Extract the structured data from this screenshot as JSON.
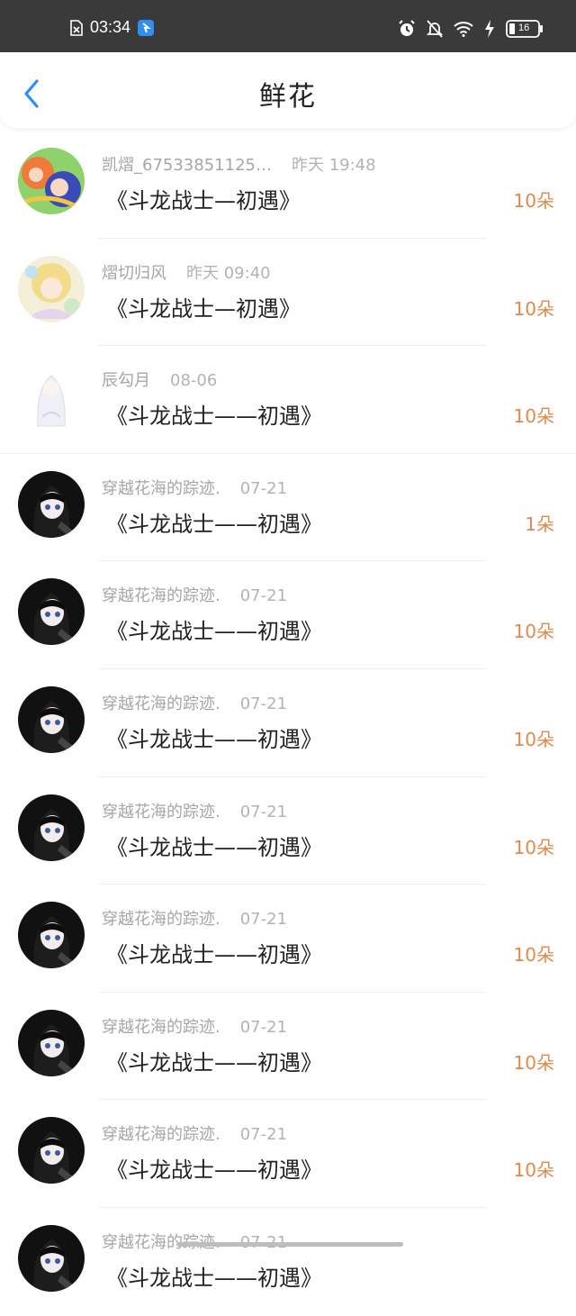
{
  "status_bar": {
    "time": "03:34",
    "battery": "16"
  },
  "header": {
    "title": "鲜花"
  },
  "colors": {
    "accent_blue": "#2e8ff2",
    "count_orange": "#e0894a"
  },
  "items": [
    {
      "user": "凯熠_67533851125…",
      "time": "昨天  19:48",
      "book": "《斗龙战士—初遇》",
      "count": "10朵",
      "avatar": "avatar-cartoon"
    },
    {
      "user": "熠切归风",
      "time": "昨天  09:40",
      "book": "《斗龙战士—初遇》",
      "count": "10朵",
      "avatar": "avatar-anime-pastel"
    },
    {
      "user": "辰勾月",
      "time": "08-06",
      "book": "《斗龙战士——初遇》",
      "count": "10朵",
      "avatar": "avatar-white-hair"
    },
    {
      "user": "穿越花海的踪迹.",
      "time": "07-21",
      "book": "《斗龙战士——初遇》",
      "count": "1朵",
      "avatar": "avatar-dark-hair"
    },
    {
      "user": "穿越花海的踪迹.",
      "time": "07-21",
      "book": "《斗龙战士——初遇》",
      "count": "10朵",
      "avatar": "avatar-dark-hair"
    },
    {
      "user": "穿越花海的踪迹.",
      "time": "07-21",
      "book": "《斗龙战士——初遇》",
      "count": "10朵",
      "avatar": "avatar-dark-hair"
    },
    {
      "user": "穿越花海的踪迹.",
      "time": "07-21",
      "book": "《斗龙战士——初遇》",
      "count": "10朵",
      "avatar": "avatar-dark-hair"
    },
    {
      "user": "穿越花海的踪迹.",
      "time": "07-21",
      "book": "《斗龙战士——初遇》",
      "count": "10朵",
      "avatar": "avatar-dark-hair"
    },
    {
      "user": "穿越花海的踪迹.",
      "time": "07-21",
      "book": "《斗龙战士——初遇》",
      "count": "10朵",
      "avatar": "avatar-dark-hair"
    },
    {
      "user": "穿越花海的踪迹.",
      "time": "07-21",
      "book": "《斗龙战士——初遇》",
      "count": "10朵",
      "avatar": "avatar-dark-hair"
    },
    {
      "user": "穿越花海的踪迹.",
      "time": "07-21",
      "book": "《斗龙战士——初遇》",
      "count": "",
      "avatar": "avatar-dark-hair"
    }
  ]
}
